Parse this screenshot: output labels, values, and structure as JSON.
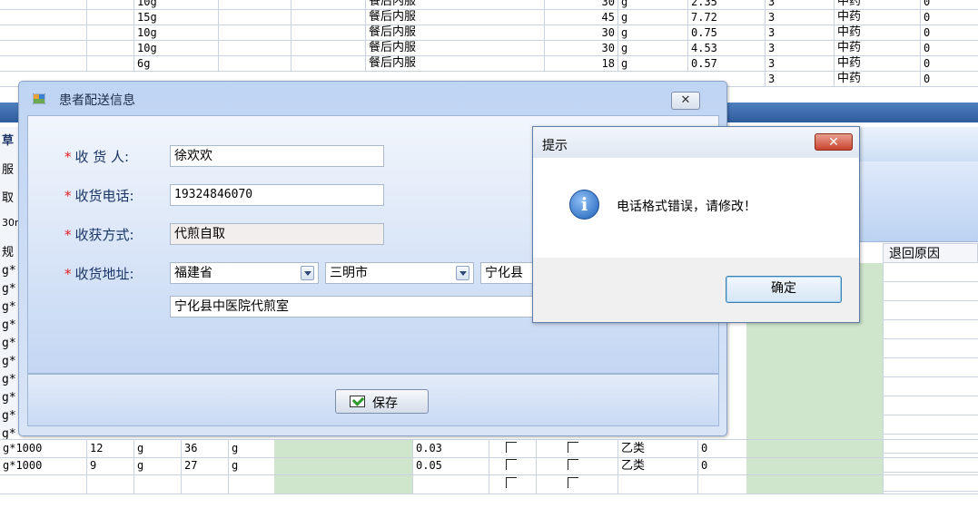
{
  "top_rows": [
    {
      "dose": "10g",
      "usage": "餐后内服",
      "qty": "30",
      "unit": "g",
      "price": "2.35",
      "n": "3",
      "type": "中药",
      "flag": "0"
    },
    {
      "dose": "15g",
      "usage": "餐后内服",
      "qty": "45",
      "unit": "g",
      "price": "7.72",
      "n": "3",
      "type": "中药",
      "flag": "0"
    },
    {
      "dose": "10g",
      "usage": "餐后内服",
      "qty": "30",
      "unit": "g",
      "price": "0.75",
      "n": "3",
      "type": "中药",
      "flag": "0"
    },
    {
      "dose": "10g",
      "usage": "餐后内服",
      "qty": "30",
      "unit": "g",
      "price": "4.53",
      "n": "3",
      "type": "中药",
      "flag": "0"
    },
    {
      "dose": "6g",
      "usage": "餐后内服",
      "qty": "18",
      "unit": "g",
      "price": "0.57",
      "n": "3",
      "type": "中药",
      "flag": "0"
    },
    {
      "dose": "",
      "usage": "",
      "qty": "",
      "unit": "",
      "price": "",
      "n": "3",
      "type": "中药",
      "flag": "0"
    }
  ],
  "left_strip": [
    "草",
    "服",
    "取",
    "30r",
    "规",
    "g*",
    "g*",
    "g*",
    "g*",
    "g*",
    "g*",
    "g*",
    "g*",
    "g*",
    "g*"
  ],
  "bottom_header": {
    "return_reason": "退回原因"
  },
  "bottom_rows": [
    {
      "spec": "g*1000",
      "a": "12",
      "au": "g",
      "b": "36",
      "bu": "g",
      "price": "0.03",
      "cat": "乙类",
      "z": "0"
    },
    {
      "spec": "g*1000",
      "a": "9",
      "au": "g",
      "b": "27",
      "bu": "g",
      "price": "0.05",
      "cat": "乙类",
      "z": "0"
    }
  ],
  "dialog": {
    "title": "患者配送信息",
    "close_glyph": "✕",
    "star": "*",
    "labels": {
      "receiver": "收 货 人:",
      "phone": "收货电话:",
      "method": "收获方式:",
      "address": "收货地址:"
    },
    "values": {
      "receiver": "徐欢欢",
      "phone": "19324846070",
      "method": "代煎自取",
      "province": "福建省",
      "city": "三明市",
      "county": "宁化县",
      "address_detail": "宁化县中医院代煎室"
    },
    "save_label": "保存"
  },
  "message_box": {
    "title": "提示",
    "close_glyph": "✕",
    "icon_glyph": "i",
    "text": "电话格式错误，请修改！",
    "ok_label": "确定"
  },
  "colors": {
    "accent": "#2e5b9c",
    "grid_green": "#cfe6cc",
    "required_star": "#e02020"
  }
}
